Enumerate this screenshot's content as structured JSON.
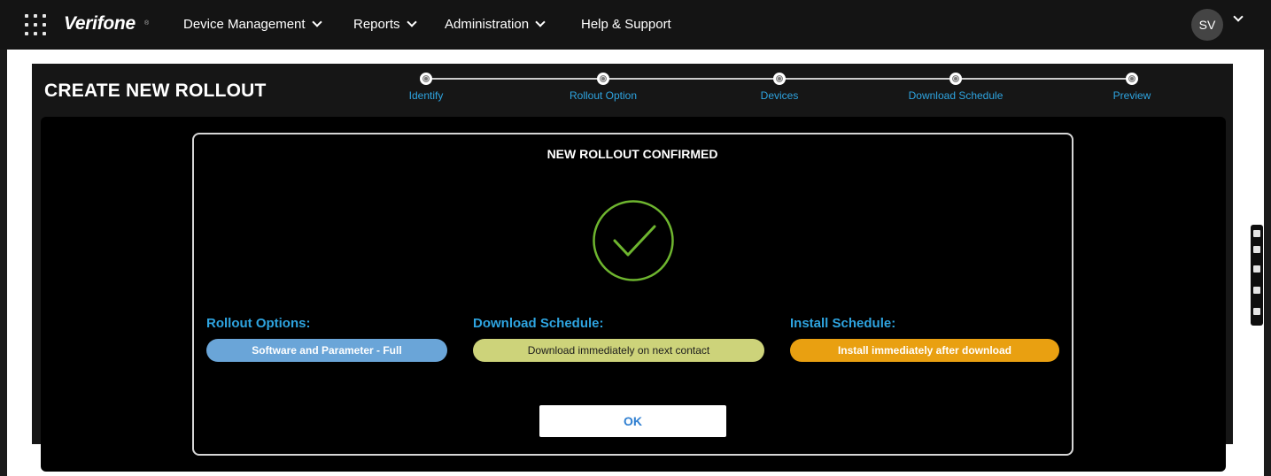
{
  "header": {
    "logo": "Verifone",
    "logo_mark": "®",
    "nav": [
      {
        "label": "Device Management",
        "has_dropdown": true
      },
      {
        "label": "Reports",
        "has_dropdown": true
      },
      {
        "label": "Administration",
        "has_dropdown": true
      },
      {
        "label": "Help & Support",
        "has_dropdown": false
      }
    ],
    "user_initials": "SV",
    "icons": {
      "apps": "grid-dots-icon",
      "user_menu": "chevron-down-icon"
    }
  },
  "wizard": {
    "title": "CREATE NEW ROLLOUT",
    "steps": [
      "Identify",
      "Rollout Option",
      "Devices",
      "Download Schedule",
      "Preview"
    ]
  },
  "modal": {
    "title": "NEW ROLLOUT CONFIRMED",
    "icon": "checkmark-circle-icon",
    "rollout_options": {
      "label": "Rollout Options:",
      "value": "Software and Parameter - Full"
    },
    "download_schedule": {
      "label": "Download Schedule:",
      "value": "Download immediately on next contact"
    },
    "install_schedule": {
      "label": "Install Schedule:",
      "value": "Install immediately after download"
    },
    "ok_label": "OK"
  },
  "colors": {
    "accent_blue": "#2ea4e0",
    "check_green": "#6eb52f",
    "rollout_pill": "#6aa5d8",
    "download_pill": "#cdd37a",
    "install_pill": "#e9a011",
    "ok_text": "#2f7fd1"
  }
}
